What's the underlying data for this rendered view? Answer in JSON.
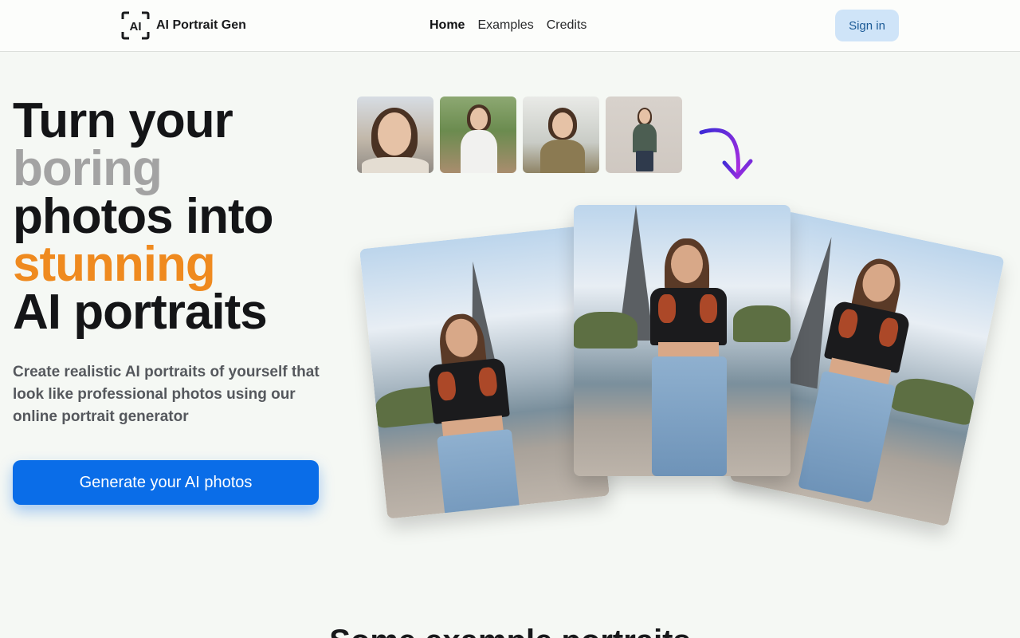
{
  "header": {
    "logo_mark": "AI",
    "logo_text": "AI Portrait Gen",
    "nav": [
      {
        "label": "Home",
        "active": true
      },
      {
        "label": "Examples",
        "active": false
      },
      {
        "label": "Credits",
        "active": false
      }
    ],
    "signin_label": "Sign in"
  },
  "hero": {
    "headline": [
      {
        "text": "Turn your",
        "color": "#141517"
      },
      {
        "text": "boring",
        "color": "#a3a3a3"
      },
      {
        "text": "photos into",
        "color": "#141517"
      },
      {
        "text": "stunning",
        "color": "#ef8a1f"
      },
      {
        "text": "AI portraits",
        "color": "#141517"
      }
    ],
    "subtitle": "Create realistic AI portraits of yourself that look like professional photos using our online portrait generator",
    "cta_label": "Generate your AI photos"
  },
  "input_photos": [
    "selfie-1",
    "selfie-2",
    "selfie-3",
    "selfie-4"
  ],
  "output_portraits": [
    "portrait-eiffel-left",
    "portrait-eiffel-center",
    "portrait-eiffel-right"
  ],
  "section_title": "Some example portraits",
  "colors": {
    "accent_blue": "#0a6de8",
    "accent_orange": "#ef8a1f",
    "arrow_gradient": [
      "#3d2bd6",
      "#b02de0"
    ]
  }
}
